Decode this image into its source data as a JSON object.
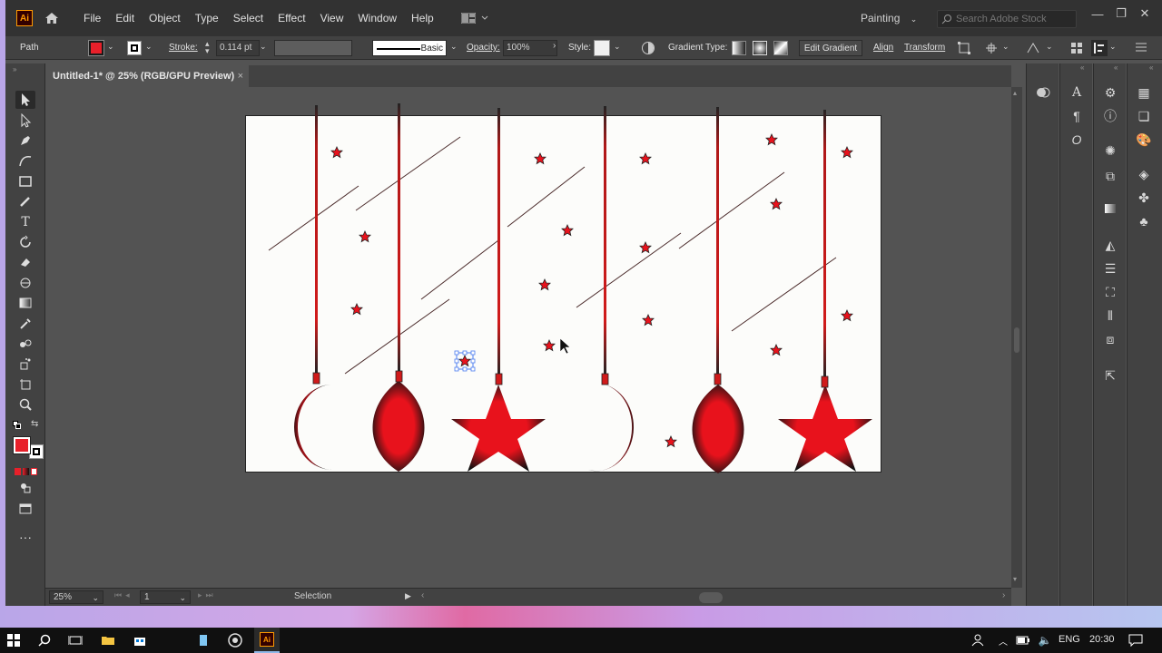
{
  "app": {
    "logo": "Ai",
    "menu": [
      "File",
      "Edit",
      "Object",
      "Type",
      "Select",
      "Effect",
      "View",
      "Window",
      "Help"
    ],
    "workspace": "Painting",
    "search_placeholder": "Search Adobe Stock"
  },
  "controlbar": {
    "selection_type": "Path",
    "stroke_label": "Stroke:",
    "stroke_weight": "0.114 pt",
    "brush_label": "Basic",
    "opacity_label": "Opacity:",
    "opacity_value": "100%",
    "style_label": "Style:",
    "gradient_type_label": "Gradient Type:",
    "edit_gradient": "Edit Gradient",
    "align": "Align",
    "transform": "Transform",
    "fill_color": "#e8202a"
  },
  "document": {
    "tab_title": "Untitled-1* @ 25% (RGB/GPU Preview)",
    "close": "×"
  },
  "status": {
    "zoom": "25%",
    "page": "1",
    "tool_name": "Selection"
  },
  "taskbar": {
    "language": "ENG",
    "time": "20:30"
  },
  "colors": {
    "ornament_red": "#e8121c",
    "ornament_dark": "#1a1a1a",
    "artboard": "#fcfcfa"
  }
}
